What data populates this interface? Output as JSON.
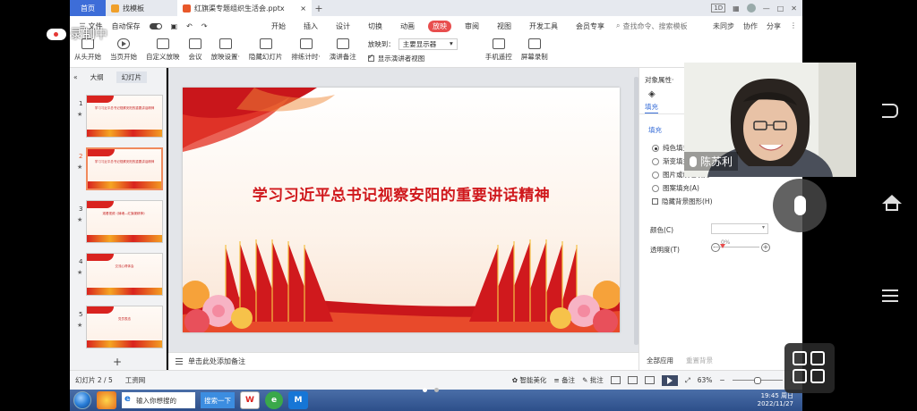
{
  "tabs": {
    "home": "首页",
    "template": "找模板",
    "doc": "红旗渠专题组织生活会.pptx",
    "plus": "+",
    "badge": "1D"
  },
  "menubar": {
    "file": "三 文件",
    "autosave": "自动保存",
    "tabs": [
      "开始",
      "插入",
      "设计",
      "切换",
      "动画",
      "放映",
      "审阅",
      "视图",
      "开发工具",
      "会员专享"
    ],
    "active_index": 5,
    "search": "查找命令、搜索模板",
    "sync": "未同步",
    "collab": "协作",
    "share": "分享"
  },
  "ribbon": {
    "buttons": [
      "从头开始",
      "当页开始",
      "自定义放映",
      "会议",
      "放映设置·",
      "隐藏幻灯片",
      "排练计时·",
      "演讲备注"
    ],
    "show_to_label": "放映到：",
    "show_to_value": "主要显示器",
    "presenter_view": "显示演讲者视图",
    "phone_remote": "手机遥控",
    "screen_record": "屏幕录制"
  },
  "overlay": {
    "recording": "录制中",
    "participant": "陈苏利"
  },
  "thumbnails": {
    "tab_outline": "大纲",
    "tab_slides": "幻灯片",
    "items": [
      {
        "num": "1",
        "text": "学习习近平总书记视察安阳的重要讲话精神"
      },
      {
        "num": "2",
        "text": "学习习近平总书记视察安阳的重要讲话精神"
      },
      {
        "num": "3",
        "text": "观看视频《铸魂—红旗渠精神》"
      },
      {
        "num": "4",
        "text": "交流心得体会"
      },
      {
        "num": "5",
        "text": "党员表态"
      }
    ],
    "selected": 1
  },
  "slide": {
    "title": "学习习近平总书记视察安阳的重要讲话精神"
  },
  "notes": {
    "placeholder": "单击此处添加备注"
  },
  "props": {
    "title": "对象属性·",
    "tab_fill": "填充",
    "section": "填充",
    "options": [
      "纯色填充",
      "渐变填充",
      "图片或纹理填充",
      "图案填充(A)",
      "隐藏背景图形(H)"
    ],
    "color_label": "颜色(C)",
    "transparency_label": "透明度(T)",
    "transparency_value": "0%",
    "apply_all": "全部应用",
    "reset_bg": "重置背景"
  },
  "status": {
    "slide_counter": "幻灯片 2 / 5",
    "theme": "工资网",
    "smart_beautify": "智能美化",
    "notes": "备注",
    "comments": "批注",
    "zoom": "63%"
  },
  "taskbar": {
    "search_placeholder": "输入你想搜的",
    "search_button": "搜索一下",
    "time": "19:45 周日",
    "date": "2022/11/27"
  },
  "colors": {
    "accent": "#e84e4e",
    "slide_title": "#d0191d",
    "ribbon_blue": "#3a6fd8"
  }
}
